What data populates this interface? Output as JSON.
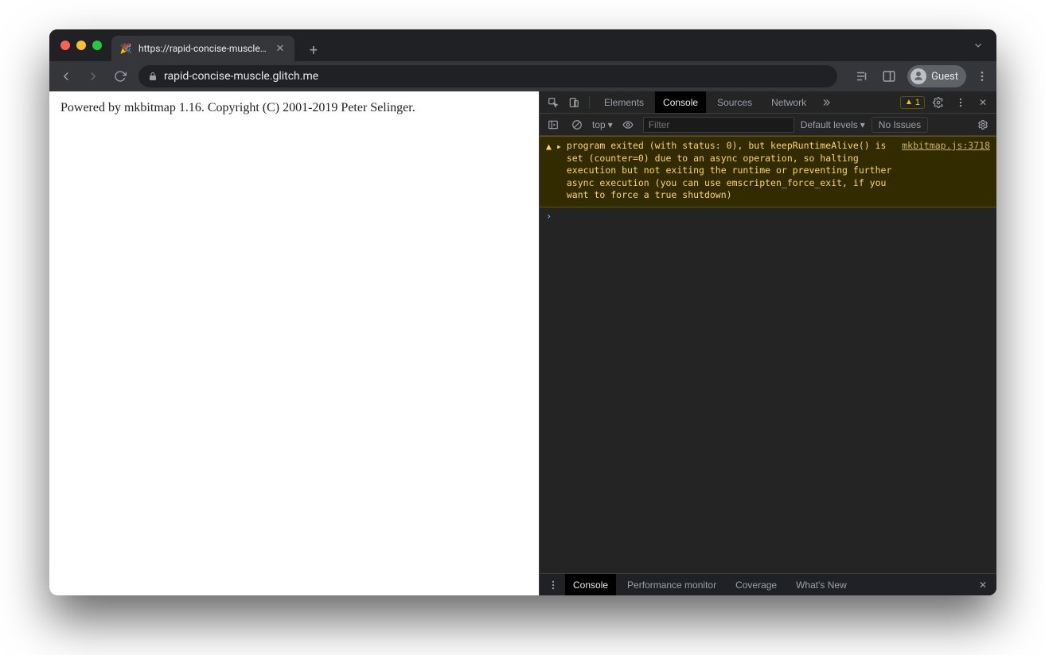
{
  "browser": {
    "tab_title": "https://rapid-concise-muscle.g",
    "favicon_emoji": "🎉",
    "url_display": "rapid-concise-muscle.glitch.me",
    "guest_label": "Guest"
  },
  "page": {
    "body_text": "Powered by mkbitmap 1.16. Copyright (C) 2001-2019 Peter Selinger."
  },
  "devtools": {
    "tabs": {
      "elements": "Elements",
      "console": "Console",
      "sources": "Sources",
      "network": "Network"
    },
    "warning_count": "1",
    "filter": {
      "context_label": "top",
      "filter_placeholder": "Filter",
      "default_levels": "Default levels",
      "no_issues": "No Issues"
    },
    "log_warning": {
      "text": "program exited (with status: 0), but keepRuntimeAlive() is set (counter=0) due to an async operation, so halting execution but not exiting the runtime or preventing further async execution (you can use emscripten_force_exit, if you want to force a true shutdown)",
      "source": "mkbitmap.js:3718"
    },
    "drawer": {
      "console": "Console",
      "perfmon": "Performance monitor",
      "coverage": "Coverage",
      "whatsnew": "What's New"
    }
  }
}
